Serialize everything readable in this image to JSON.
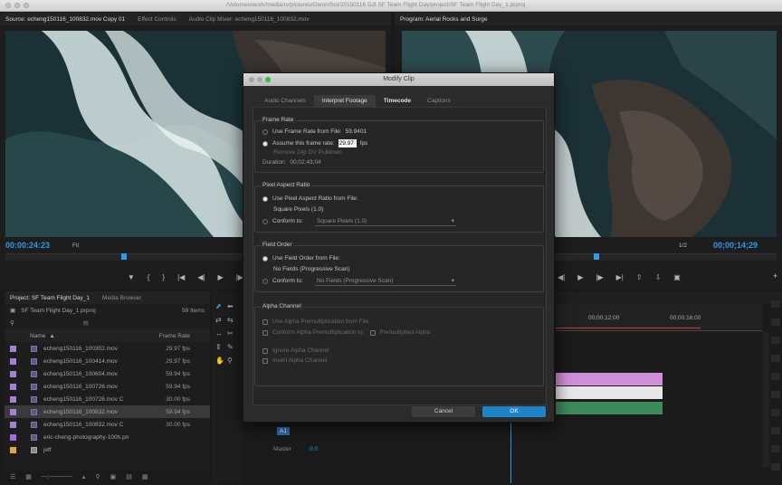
{
  "window": {
    "path": "/Volumes/work/media/rv/pictures/Glenn/Sol/20150116 DJI SF Team Flight Day/project/SF Team Flight Day_1.prproj"
  },
  "source_panel": {
    "tabs": [
      "Source: echeng150116_100832.mov Copy 01",
      "Effect Controls",
      "Audio Clip Mixer: echeng150116_100832.mov"
    ],
    "timecode": "00:00:24:23",
    "fit": "Fit"
  },
  "program_panel": {
    "tab": "Program: Aerial Rocks and Surge",
    "zoom": "1/2",
    "timecode": "00;00;14;29"
  },
  "project_panel": {
    "tabs": [
      "Project: SF Team Flight Day_1",
      "Media Browser"
    ],
    "project_file": "SF Team Flight Day_1.prproj",
    "item_count": "59 Items",
    "col_name": "Name",
    "col_rate": "Frame Rate",
    "items": [
      {
        "name": "echeng150116_100302.mov",
        "rate": "29.97 fps",
        "color": "#a77fd6"
      },
      {
        "name": "echeng150116_100414.mov",
        "rate": "29.97 fps",
        "color": "#a77fd6"
      },
      {
        "name": "echeng150116_100604.mov",
        "rate": "59.94 fps",
        "color": "#a77fd6"
      },
      {
        "name": "echeng150116_100726.mov",
        "rate": "59.94 fps",
        "color": "#a77fd6"
      },
      {
        "name": "echeng150116_100726.mov C",
        "rate": "30.00 fps",
        "color": "#a77fd6"
      },
      {
        "name": "echeng150116_100832.mov",
        "rate": "59.94 fps",
        "color": "#a77fd6"
      },
      {
        "name": "echeng150116_100832.mov C",
        "rate": "30.00 fps",
        "color": "#a77fd6"
      },
      {
        "name": "eric-cheng-photography-100h.pn",
        "rate": "",
        "color": "#9b6fe0"
      },
      {
        "name": "jeff",
        "rate": "",
        "color": "#e8a33a"
      }
    ]
  },
  "timeline": {
    "times": [
      "00;00;12;00",
      "00;00;16;00"
    ],
    "track_a1": "A1",
    "master": "Master",
    "master_val": "0.0"
  },
  "dialog": {
    "title": "Modify Clip",
    "tabs": [
      "Audio Channels",
      "Interpret Footage",
      "Timecode",
      "Captions"
    ],
    "frame_rate": {
      "title": "Frame Rate",
      "use_from_file": "Use Frame Rate from File:",
      "file_rate": "59.9401",
      "assume": "Assume this frame rate:",
      "assume_value": "29.97",
      "fps": "fps",
      "remove_pulldown": "Remove 24p DV Pulldown",
      "duration_label": "Duration:",
      "duration": "00;02;43;04"
    },
    "pixel_aspect": {
      "title": "Pixel Aspect Ratio",
      "use_from_file": "Use Pixel Aspect Ratio from File:",
      "file_value": "Square Pixels (1.0)",
      "conform": "Conform to:",
      "conform_value": "Square Pixels (1.0)"
    },
    "field_order": {
      "title": "Field Order",
      "use_from_file": "Use Field Order from File:",
      "file_value": "No Fields (Progressive Scan)",
      "conform": "Conform to:",
      "conform_value": "No Fields (Progressive Scan)"
    },
    "alpha": {
      "title": "Alpha Channel",
      "use_premult": "Use Alpha Premultiplication from File",
      "conform": "Conform Alpha Premultiplication to:",
      "premult": "Premultiplied Alpha",
      "ignore": "Ignore Alpha Channel",
      "invert": "Invert Alpha Channel"
    },
    "cancel": "Cancel",
    "ok": "OK"
  }
}
